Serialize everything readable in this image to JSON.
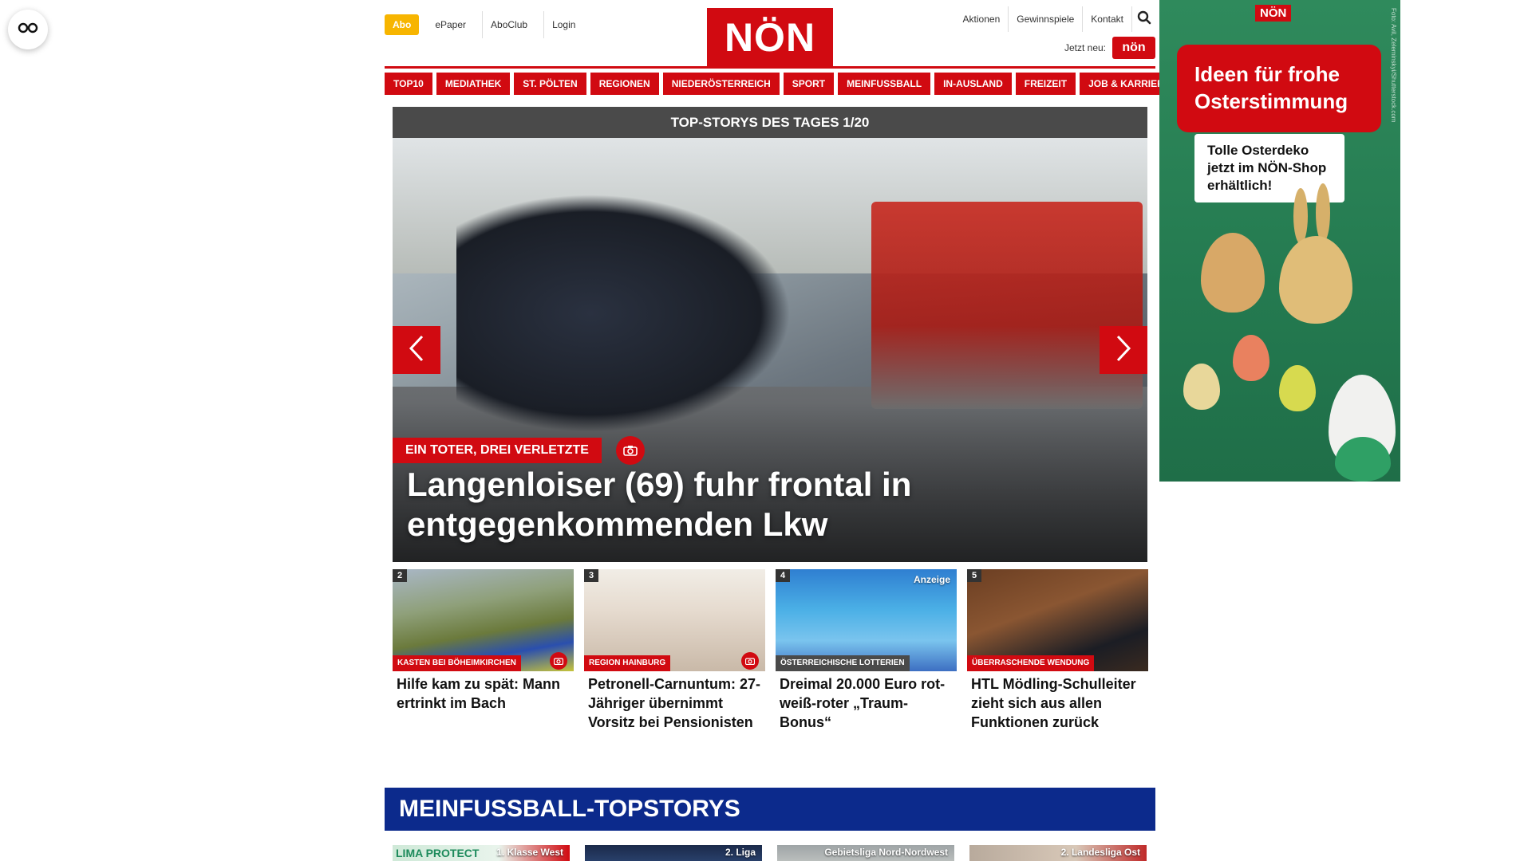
{
  "header": {
    "abo_label": "Abo",
    "left_links": [
      "ePaper",
      "AboClub",
      "Login"
    ],
    "logo_text": "NÖN",
    "right_links": [
      "Aktionen",
      "Gewinnspiele",
      "Kontakt"
    ],
    "jetzt_label": "Jetzt neu:",
    "mini_logo_text": "nön"
  },
  "nav": {
    "items": [
      "TOP10",
      "MEDIATHEK",
      "ST. PÖLTEN",
      "REGIONEN",
      "NIEDERÖSTERREICH",
      "SPORT",
      "MEINFUSSBALL",
      "IN-AUSLAND",
      "FREIZEIT",
      "JOB & KARRIERE"
    ]
  },
  "slider": {
    "bar_title": "TOP-STORYS DES TAGES 1/20",
    "kicker": "EIN TOTER, DREI VERLETZTE",
    "title": "Langenloiser (69) fuhr frontal in entgegenkommenden Lkw"
  },
  "cards": [
    {
      "num": "2",
      "kicker": "KASTEN BEI BÖHEIMKIRCHEN",
      "title": "Hilfe kam zu spät: Mann ertrinkt im Bach",
      "ad": ""
    },
    {
      "num": "3",
      "kicker": "REGION HAINBURG",
      "title": "Petronell-Carnuntum: 27-Jähriger übernimmt Vorsitz bei Pensionisten",
      "ad": ""
    },
    {
      "num": "4",
      "kicker": "ÖSTERREICHISCHE LOTTERIEN",
      "title": "Dreimal 20.000 Euro rot-weiß-roter „Traum-Bonus“",
      "ad": "Anzeige"
    },
    {
      "num": "5",
      "kicker": "ÜBERRASCHENDE WENDUNG",
      "title": "HTL Mödling-Schulleiter zieht sich aus allen Funktionen zurück",
      "ad": ""
    }
  ],
  "section": {
    "title": "MEINFUSSBALL-TOPSTORYS"
  },
  "teasers": [
    {
      "tag": "1. Klasse West",
      "brand": "LIMA PROTECT"
    },
    {
      "tag": "2. Liga"
    },
    {
      "tag": "Gebietsliga Nord-Nordwest"
    },
    {
      "tag": "2. Landesliga Ost"
    }
  ],
  "ad": {
    "logo": "NÖN",
    "headline": "Ideen für frohe Osterstimmung",
    "note": "Tolle Osterdeko jetzt im NÖN-Shop erhältlich!",
    "egg_label": "Easter",
    "credit": "Foto: Avil, Zeleminskyi/Shutterstock.com"
  },
  "colors": {
    "brand_red": "#d10a11",
    "abo_yellow": "#f7b500",
    "section_blue": "#0c2a8c",
    "ad_green": "#2f8a5c"
  },
  "icons": {
    "fab": "glasses-icon",
    "search": "search-icon",
    "prev": "chevron-left-icon",
    "next": "chevron-right-icon",
    "camera": "camera-icon"
  }
}
